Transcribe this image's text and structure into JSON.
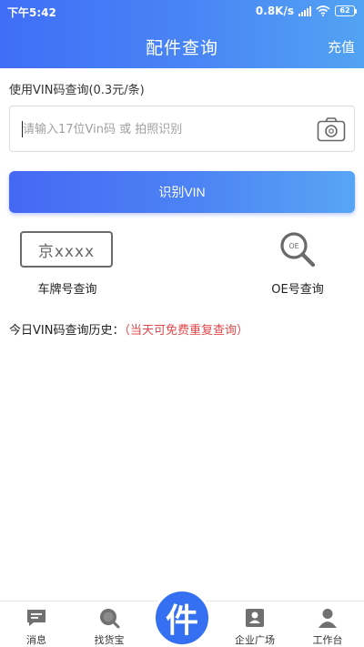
{
  "status_bar": {
    "time": "下午5:42",
    "speed": "0.8K/s",
    "battery": "62"
  },
  "nav": {
    "title": "配件查询",
    "recharge": "充值"
  },
  "vin_query": {
    "hint": "使用VIN码查询(0.3元/条)",
    "input_placeholder": "请输入17位Vin码 或 拍照识别",
    "input_value": "",
    "recognize_button": "识别VIN"
  },
  "options": {
    "plate_sample": "京xxxx",
    "plate_label": "车牌号查询",
    "oe_icon_text": "OE",
    "oe_label": "OE号查询"
  },
  "history": {
    "title": "今日VIN码查询历史：",
    "note": "（当天可免费重复查询）"
  },
  "tabbar": {
    "items": [
      {
        "label": "消息",
        "icon": "message-icon"
      },
      {
        "label": "找货宝",
        "icon": "search-icon"
      },
      {
        "label": "企业广场",
        "icon": "contact-card-icon"
      },
      {
        "label": "工作台",
        "icon": "user-icon"
      }
    ],
    "center_glyph": "件"
  },
  "colors": {
    "primary": "#3f6ef6",
    "accent_note": "#e0474a"
  }
}
